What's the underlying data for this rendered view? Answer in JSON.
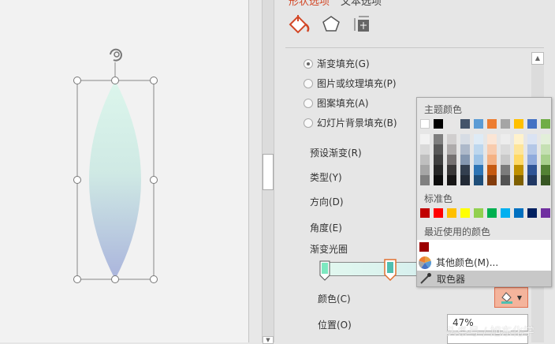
{
  "pane_tabs": {
    "shape_options": "形状选项",
    "text_options": "文本选项"
  },
  "pane_icons": [
    "fill-line-icon",
    "effects-icon",
    "size-properties-icon"
  ],
  "fill_options": [
    {
      "label": "渐变填充(G)",
      "selected": true
    },
    {
      "label": "图片或纹理填充(P)",
      "selected": false
    },
    {
      "label": "图案填充(A)",
      "selected": false
    },
    {
      "label": "幻灯片背景填充(B)",
      "selected": false
    }
  ],
  "fields": {
    "preset": "预设渐变(R)",
    "type": "类型(Y)",
    "direction": "方向(D)",
    "angle": "角度(E)",
    "gradient_stops": "渐变光圈",
    "color": "颜色(C)",
    "position": "位置(O)",
    "position_value": "47%"
  },
  "gradient": {
    "stops": [
      {
        "position": 0,
        "color": "#7de8c0"
      },
      {
        "position": 47,
        "color": "#4fbfb0",
        "selected": true
      }
    ]
  },
  "color_menu": {
    "theme_label": "主题颜色",
    "theme_colors": [
      "#ffffff",
      "#000000",
      "#e7e6e6",
      "#44546a",
      "#5b9bd5",
      "#ed7d31",
      "#a5a5a5",
      "#ffc000",
      "#4472c4",
      "#70ad47"
    ],
    "theme_shades": [
      [
        "#f2f2f2",
        "#d9d9d9",
        "#bfbfbf",
        "#a6a6a6",
        "#808080"
      ],
      [
        "#7f7f7f",
        "#595959",
        "#404040",
        "#262626",
        "#0d0d0d"
      ],
      [
        "#d0cece",
        "#aeabab",
        "#757171",
        "#3a3838",
        "#171616"
      ],
      [
        "#d6dce4",
        "#adb9ca",
        "#8497b0",
        "#333f4f",
        "#222a35"
      ],
      [
        "#deebf6",
        "#bdd7ee",
        "#9dc3e6",
        "#2e75b5",
        "#1f4e79"
      ],
      [
        "#fbe5d5",
        "#f8cbad",
        "#f4b183",
        "#c55a11",
        "#833c0b"
      ],
      [
        "#ededed",
        "#dbdbdb",
        "#c9c9c9",
        "#7b7b7b",
        "#525252"
      ],
      [
        "#fff2cc",
        "#fee599",
        "#ffd965",
        "#bf9000",
        "#7f6000"
      ],
      [
        "#dae3f3",
        "#b4c7e7",
        "#8faadc",
        "#2f5496",
        "#203864"
      ],
      [
        "#e2efd9",
        "#c5e0b3",
        "#a8d08d",
        "#538135",
        "#375623"
      ]
    ],
    "standard_label": "标准色",
    "standard_colors": [
      "#c00000",
      "#ff0000",
      "#ffc000",
      "#ffff00",
      "#92d050",
      "#00b050",
      "#00b0f0",
      "#0070c0",
      "#002060",
      "#7030a0"
    ],
    "recent_label": "最近使用的颜色",
    "recent_colors": [
      "#9c0000"
    ],
    "more_colors": "其他颜色(M)...",
    "eyedropper": "取色器"
  },
  "watermark": "头条号 / 旭东化学",
  "colors": {
    "accent": "#d24726",
    "color_button_bg": "#f4b49c"
  }
}
